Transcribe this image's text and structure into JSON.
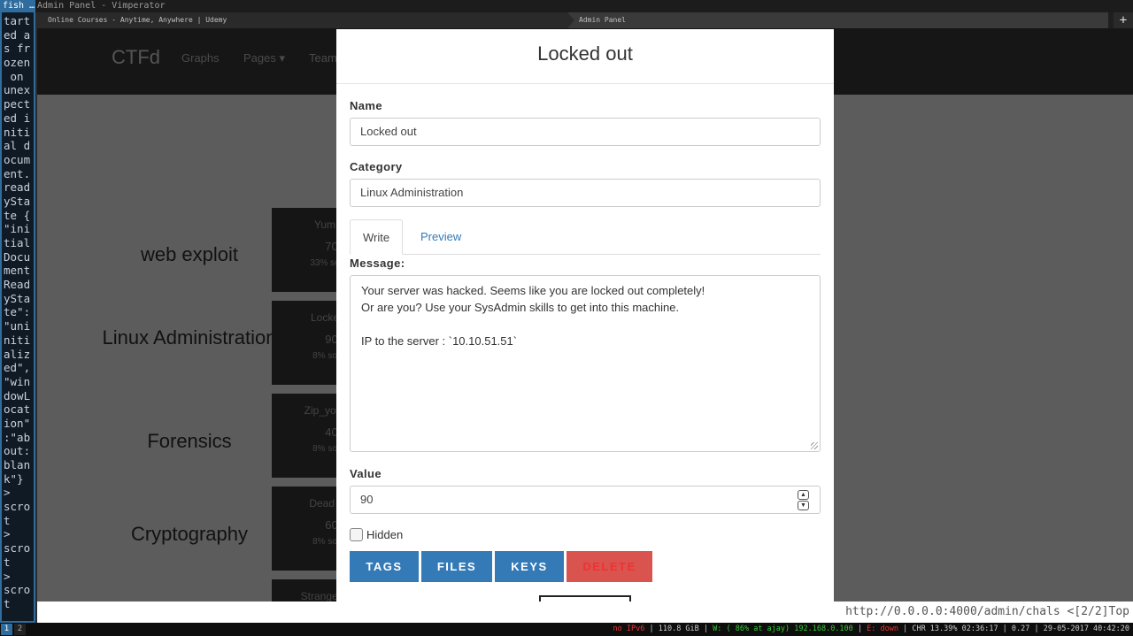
{
  "wm": {
    "terminal_title": "fish …",
    "window_title": "Admin Panel - Vimperator"
  },
  "terminal": {
    "lines": [
      "tart",
      "ed a",
      "s fr",
      "ozen",
      " on",
      "unex",
      "pect",
      "ed i",
      "niti",
      "al d",
      "ocum",
      "ent.",
      "read",
      "ySta",
      "te {",
      "\"ini",
      "tial",
      "Docu",
      "ment",
      "Read",
      "ySta",
      "te\":",
      "\"uni",
      "niti",
      "aliz",
      "ed\",",
      "\"win",
      "dowL",
      "ocat",
      "ion\"",
      ":\"ab",
      "out:",
      "blan",
      "k\"}",
      "> ",
      "scro",
      "t",
      "> ",
      "scro",
      "t",
      "> ",
      "scro",
      "t"
    ]
  },
  "browser": {
    "tabs": [
      {
        "label": "Online Courses - Anytime, Anywhere | Udemy"
      },
      {
        "label": "Admin Panel"
      }
    ],
    "new_tab_icon": "+",
    "status_url": "http://0.0.0.0:4000/admin/chals",
    "status_pos": "<[2/2]Top"
  },
  "site": {
    "brand": "CTFd",
    "nav": [
      {
        "label": "Graphs"
      },
      {
        "label": "Pages ▾"
      },
      {
        "label": "Team"
      }
    ],
    "categories": [
      {
        "label": "web exploit"
      },
      {
        "label": "Linux Administration"
      },
      {
        "label": "Forensics"
      },
      {
        "label": "Cryptography"
      }
    ],
    "challenges": [
      {
        "name": "Yum",
        "value": "70",
        "solves": "33% so"
      },
      {
        "name": "Locke",
        "value": "90",
        "solves": "8% so"
      },
      {
        "name": "Zip_your",
        "value": "40",
        "solves": "8% so"
      },
      {
        "name": "Dead I",
        "value": "60",
        "solves": "8% so"
      },
      {
        "name": "Strange O",
        "value": "",
        "solves": ""
      }
    ]
  },
  "modal": {
    "title": "Locked out",
    "name_label": "Name",
    "name_value": "Locked out",
    "category_label": "Category",
    "category_value": "Linux Administration",
    "tab_write": "Write",
    "tab_preview": "Preview",
    "message_label": "Message:",
    "message_lines": [
      "Your server was hacked. Seems like you are locked out completely!",
      "Or are you? Use your SysAdmin skills to get into this machine.",
      "",
      "IP to the server : `10.10.51.51`"
    ],
    "value_label": "Value",
    "value_value": "90",
    "hidden_label": "Hidden",
    "hidden_checked": false,
    "buttons": {
      "tags": "TAGS",
      "files": "FILES",
      "keys": "KEYS",
      "delete": "DELETE"
    }
  },
  "bottombar": {
    "ws1": "1",
    "ws2": "2",
    "ipv6": "no IPv6",
    "disk": "110.8 GiB",
    "wifi": "W: ( 86% at ajay) 192.168.0.100",
    "eth": "E: down",
    "chr": "CHR 13.39% 02:36:17",
    "load": "0.27",
    "datetime": "29-05-2017 40:42:20"
  },
  "colors": {
    "primary": "#337ab7",
    "danger": "#d9534f",
    "wm_accent": "#2f6d9e"
  }
}
